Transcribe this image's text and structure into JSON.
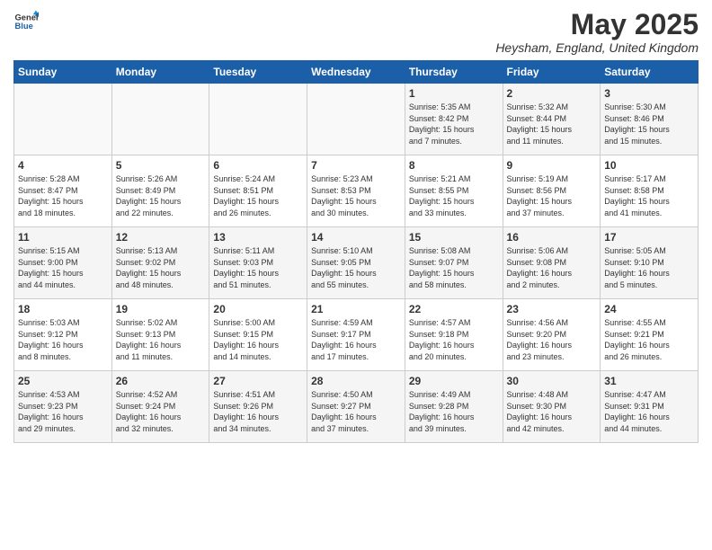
{
  "header": {
    "logo": {
      "line1": "General",
      "line2": "Blue"
    },
    "title": "May 2025",
    "location": "Heysham, England, United Kingdom"
  },
  "calendar": {
    "days_of_week": [
      "Sunday",
      "Monday",
      "Tuesday",
      "Wednesday",
      "Thursday",
      "Friday",
      "Saturday"
    ],
    "weeks": [
      [
        {
          "day": "",
          "content": ""
        },
        {
          "day": "",
          "content": ""
        },
        {
          "day": "",
          "content": ""
        },
        {
          "day": "",
          "content": ""
        },
        {
          "day": "1",
          "content": "Sunrise: 5:35 AM\nSunset: 8:42 PM\nDaylight: 15 hours\nand 7 minutes."
        },
        {
          "day": "2",
          "content": "Sunrise: 5:32 AM\nSunset: 8:44 PM\nDaylight: 15 hours\nand 11 minutes."
        },
        {
          "day": "3",
          "content": "Sunrise: 5:30 AM\nSunset: 8:46 PM\nDaylight: 15 hours\nand 15 minutes."
        }
      ],
      [
        {
          "day": "4",
          "content": "Sunrise: 5:28 AM\nSunset: 8:47 PM\nDaylight: 15 hours\nand 18 minutes."
        },
        {
          "day": "5",
          "content": "Sunrise: 5:26 AM\nSunset: 8:49 PM\nDaylight: 15 hours\nand 22 minutes."
        },
        {
          "day": "6",
          "content": "Sunrise: 5:24 AM\nSunset: 8:51 PM\nDaylight: 15 hours\nand 26 minutes."
        },
        {
          "day": "7",
          "content": "Sunrise: 5:23 AM\nSunset: 8:53 PM\nDaylight: 15 hours\nand 30 minutes."
        },
        {
          "day": "8",
          "content": "Sunrise: 5:21 AM\nSunset: 8:55 PM\nDaylight: 15 hours\nand 33 minutes."
        },
        {
          "day": "9",
          "content": "Sunrise: 5:19 AM\nSunset: 8:56 PM\nDaylight: 15 hours\nand 37 minutes."
        },
        {
          "day": "10",
          "content": "Sunrise: 5:17 AM\nSunset: 8:58 PM\nDaylight: 15 hours\nand 41 minutes."
        }
      ],
      [
        {
          "day": "11",
          "content": "Sunrise: 5:15 AM\nSunset: 9:00 PM\nDaylight: 15 hours\nand 44 minutes."
        },
        {
          "day": "12",
          "content": "Sunrise: 5:13 AM\nSunset: 9:02 PM\nDaylight: 15 hours\nand 48 minutes."
        },
        {
          "day": "13",
          "content": "Sunrise: 5:11 AM\nSunset: 9:03 PM\nDaylight: 15 hours\nand 51 minutes."
        },
        {
          "day": "14",
          "content": "Sunrise: 5:10 AM\nSunset: 9:05 PM\nDaylight: 15 hours\nand 55 minutes."
        },
        {
          "day": "15",
          "content": "Sunrise: 5:08 AM\nSunset: 9:07 PM\nDaylight: 15 hours\nand 58 minutes."
        },
        {
          "day": "16",
          "content": "Sunrise: 5:06 AM\nSunset: 9:08 PM\nDaylight: 16 hours\nand 2 minutes."
        },
        {
          "day": "17",
          "content": "Sunrise: 5:05 AM\nSunset: 9:10 PM\nDaylight: 16 hours\nand 5 minutes."
        }
      ],
      [
        {
          "day": "18",
          "content": "Sunrise: 5:03 AM\nSunset: 9:12 PM\nDaylight: 16 hours\nand 8 minutes."
        },
        {
          "day": "19",
          "content": "Sunrise: 5:02 AM\nSunset: 9:13 PM\nDaylight: 16 hours\nand 11 minutes."
        },
        {
          "day": "20",
          "content": "Sunrise: 5:00 AM\nSunset: 9:15 PM\nDaylight: 16 hours\nand 14 minutes."
        },
        {
          "day": "21",
          "content": "Sunrise: 4:59 AM\nSunset: 9:17 PM\nDaylight: 16 hours\nand 17 minutes."
        },
        {
          "day": "22",
          "content": "Sunrise: 4:57 AM\nSunset: 9:18 PM\nDaylight: 16 hours\nand 20 minutes."
        },
        {
          "day": "23",
          "content": "Sunrise: 4:56 AM\nSunset: 9:20 PM\nDaylight: 16 hours\nand 23 minutes."
        },
        {
          "day": "24",
          "content": "Sunrise: 4:55 AM\nSunset: 9:21 PM\nDaylight: 16 hours\nand 26 minutes."
        }
      ],
      [
        {
          "day": "25",
          "content": "Sunrise: 4:53 AM\nSunset: 9:23 PM\nDaylight: 16 hours\nand 29 minutes."
        },
        {
          "day": "26",
          "content": "Sunrise: 4:52 AM\nSunset: 9:24 PM\nDaylight: 16 hours\nand 32 minutes."
        },
        {
          "day": "27",
          "content": "Sunrise: 4:51 AM\nSunset: 9:26 PM\nDaylight: 16 hours\nand 34 minutes."
        },
        {
          "day": "28",
          "content": "Sunrise: 4:50 AM\nSunset: 9:27 PM\nDaylight: 16 hours\nand 37 minutes."
        },
        {
          "day": "29",
          "content": "Sunrise: 4:49 AM\nSunset: 9:28 PM\nDaylight: 16 hours\nand 39 minutes."
        },
        {
          "day": "30",
          "content": "Sunrise: 4:48 AM\nSunset: 9:30 PM\nDaylight: 16 hours\nand 42 minutes."
        },
        {
          "day": "31",
          "content": "Sunrise: 4:47 AM\nSunset: 9:31 PM\nDaylight: 16 hours\nand 44 minutes."
        }
      ]
    ]
  }
}
